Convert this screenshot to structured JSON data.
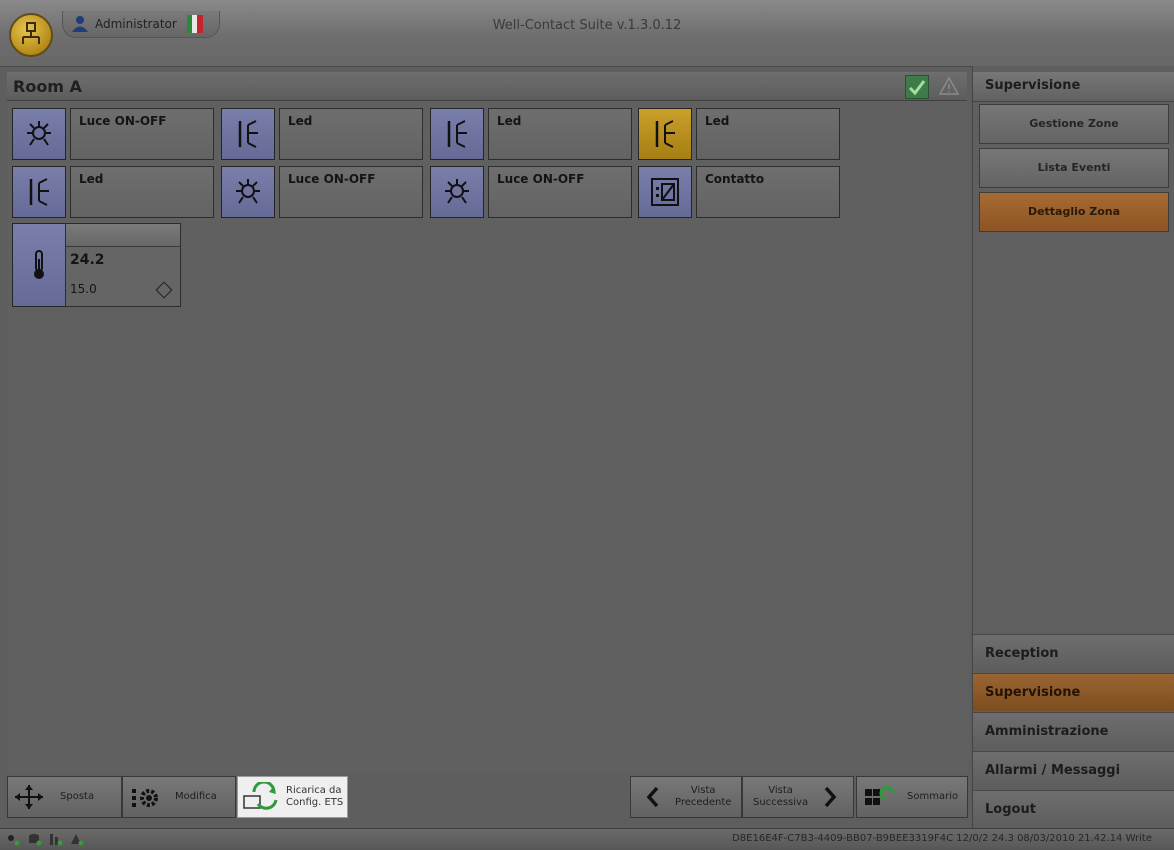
{
  "app": {
    "title": "Well-Contact Suite v.1.3.0.12",
    "user": "Administrator",
    "language_flag": "italian-flag"
  },
  "room": {
    "title": "Room A"
  },
  "tiles": [
    {
      "label": "Luce ON-OFF",
      "icon": "light-bulb-icon",
      "active": false
    },
    {
      "label": "Led",
      "icon": "led-icon",
      "active": false
    },
    {
      "label": "Led",
      "icon": "led-icon",
      "active": false
    },
    {
      "label": "Led",
      "icon": "led-icon",
      "active": true
    },
    {
      "label": "Led",
      "icon": "led-icon",
      "active": false
    },
    {
      "label": "Luce ON-OFF",
      "icon": "light-bulb-icon",
      "active": false
    },
    {
      "label": "Luce ON-OFF",
      "icon": "light-bulb-icon",
      "active": false
    },
    {
      "label": "Contatto",
      "icon": "contact-icon",
      "active": false
    }
  ],
  "thermostat": {
    "value": "24.2",
    "setpoint": "15.0"
  },
  "toolbar": {
    "sposta": "Sposta",
    "modifica": "Modifica",
    "ricarica_line1": "Ricarica da",
    "ricarica_line2": "Config. ETS",
    "prev_line1": "Vista",
    "prev_line2": "Precedente",
    "next_line1": "Vista",
    "next_line2": "Successiva",
    "sommario": "Sommario"
  },
  "right_panel": {
    "header": "Supervisione",
    "items": [
      "Gestione Zone",
      "Lista Eventi",
      "Dettaglio Zona"
    ],
    "selected_item": "Dettaglio Zona",
    "sections": [
      "Reception",
      "Supervisione",
      "Amministrazione",
      "Allarmi / Messaggi",
      "Logout"
    ],
    "selected_section": "Supervisione"
  },
  "status": {
    "text": "D8E16E4F-C7B3-4409-BB07-B9BEE3319F4C 12/0/2 24.3 08/03/2010 21.42.14 Write"
  },
  "colors": {
    "accent_orange": "#9b6532",
    "tile_blue": "#6a6e9c",
    "tile_active": "#b58a1a"
  }
}
